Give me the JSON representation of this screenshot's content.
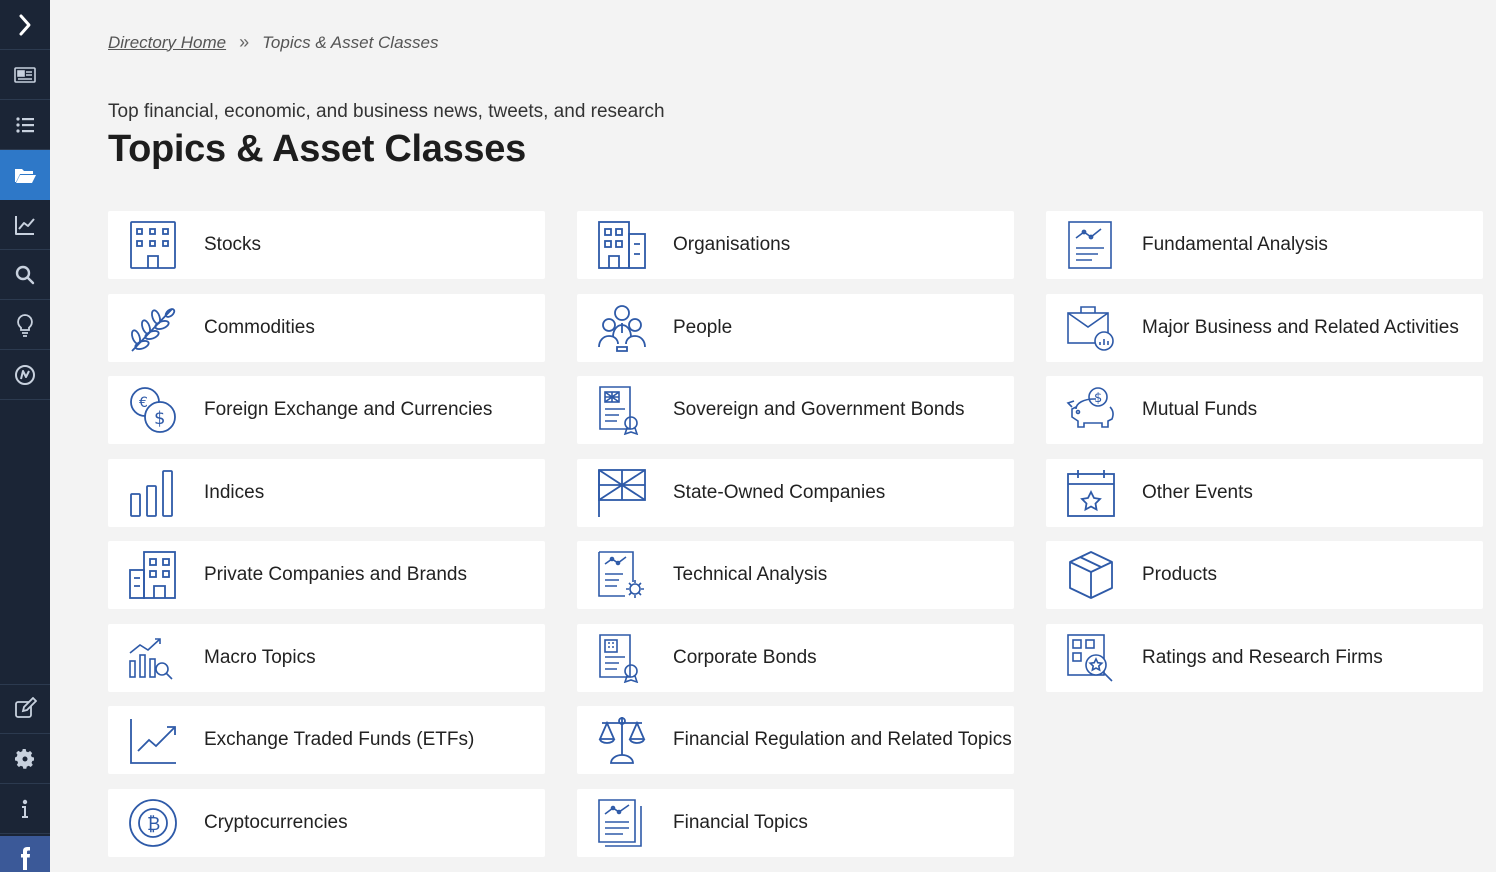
{
  "sidebar": {
    "items": [
      {
        "name": "expand-chevron-icon"
      },
      {
        "name": "newspaper-icon"
      },
      {
        "name": "list-icon"
      },
      {
        "name": "folder-open-icon"
      },
      {
        "name": "chart-line-icon"
      },
      {
        "name": "search-icon"
      },
      {
        "name": "lightbulb-icon"
      },
      {
        "name": "brand-logo-icon"
      },
      {
        "name": "edit-icon"
      },
      {
        "name": "gear-icon"
      },
      {
        "name": "info-icon"
      },
      {
        "name": "facebook-icon"
      }
    ],
    "active": "folder-open-icon"
  },
  "breadcrumb": {
    "home": "Directory Home",
    "separator": "»",
    "current": "Topics & Asset Classes"
  },
  "header": {
    "subtitle": "Top financial, economic, and business news, tweets, and research",
    "title": "Topics & Asset Classes"
  },
  "categories": {
    "col1": [
      {
        "label": "Stocks",
        "icon": "building-icon"
      },
      {
        "label": "Commodities",
        "icon": "wheat-icon"
      },
      {
        "label": "Foreign Exchange and Currencies",
        "icon": "currency-coins-icon"
      },
      {
        "label": "Indices",
        "icon": "bar-chart-icon"
      },
      {
        "label": "Private Companies and Brands",
        "icon": "office-building-icon"
      },
      {
        "label": "Macro Topics",
        "icon": "chart-magnifier-icon"
      },
      {
        "label": "Exchange Traded Funds (ETFs)",
        "icon": "trend-line-icon"
      },
      {
        "label": "Cryptocurrencies",
        "icon": "bitcoin-icon"
      }
    ],
    "col2": [
      {
        "label": "Organisations",
        "icon": "organisation-building-icon"
      },
      {
        "label": "People",
        "icon": "people-group-icon"
      },
      {
        "label": "Sovereign and Government Bonds",
        "icon": "government-bond-icon"
      },
      {
        "label": "State-Owned Companies",
        "icon": "flag-icon"
      },
      {
        "label": "Technical Analysis",
        "icon": "analysis-gear-icon"
      },
      {
        "label": "Corporate Bonds",
        "icon": "corporate-bond-icon"
      },
      {
        "label": "Financial Regulation and Related Topics",
        "icon": "scales-icon"
      },
      {
        "label": "Financial Topics",
        "icon": "report-document-icon"
      }
    ],
    "col3": [
      {
        "label": "Fundamental Analysis",
        "icon": "document-chart-icon"
      },
      {
        "label": "Major Business and Related Activities",
        "icon": "briefcase-chart-icon"
      },
      {
        "label": "Mutual Funds",
        "icon": "piggy-bank-icon"
      },
      {
        "label": "Other Events",
        "icon": "calendar-star-icon"
      },
      {
        "label": "Products",
        "icon": "box-icon"
      },
      {
        "label": "Ratings and Research Firms",
        "icon": "rating-magnifier-icon"
      }
    ]
  },
  "colors": {
    "sidebar_bg": "#1b2536",
    "sidebar_active": "#2e78c8",
    "icon_blue": "#2e5aa8",
    "page_bg": "#f3f3f3"
  }
}
